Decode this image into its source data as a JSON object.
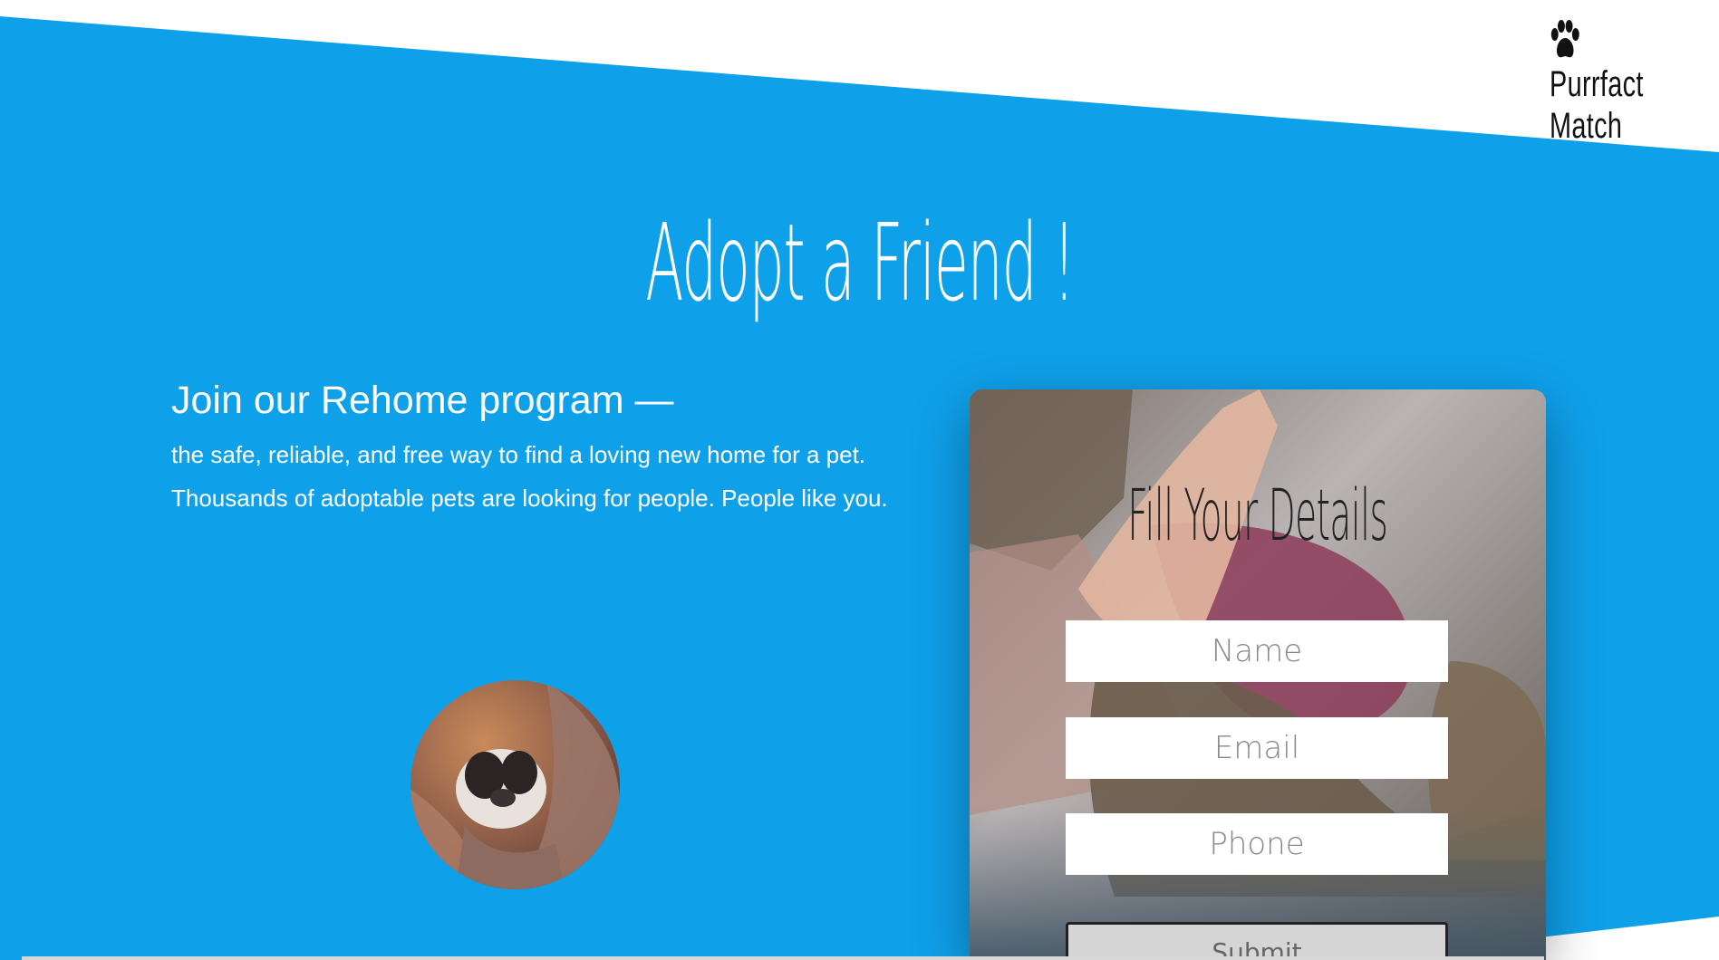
{
  "brand": {
    "icon": "paw-icon",
    "line1": "Purrfact",
    "line2": "Match"
  },
  "hero": {
    "title": "Adopt a Friend !",
    "heading": "Join our Rehome program —",
    "body": "the safe, reliable, and free way to find a loving new home for a pet. Thousands of adoptable pets are looking for people. People like you."
  },
  "form": {
    "title": "Fill Your Details",
    "name_placeholder": "Name",
    "email_placeholder": "Email",
    "phone_placeholder": "Phone",
    "submit_label": "Submit"
  },
  "colors": {
    "primary_blue": "#0fa0ea",
    "white": "#ffffff",
    "dark_text": "#111111"
  }
}
